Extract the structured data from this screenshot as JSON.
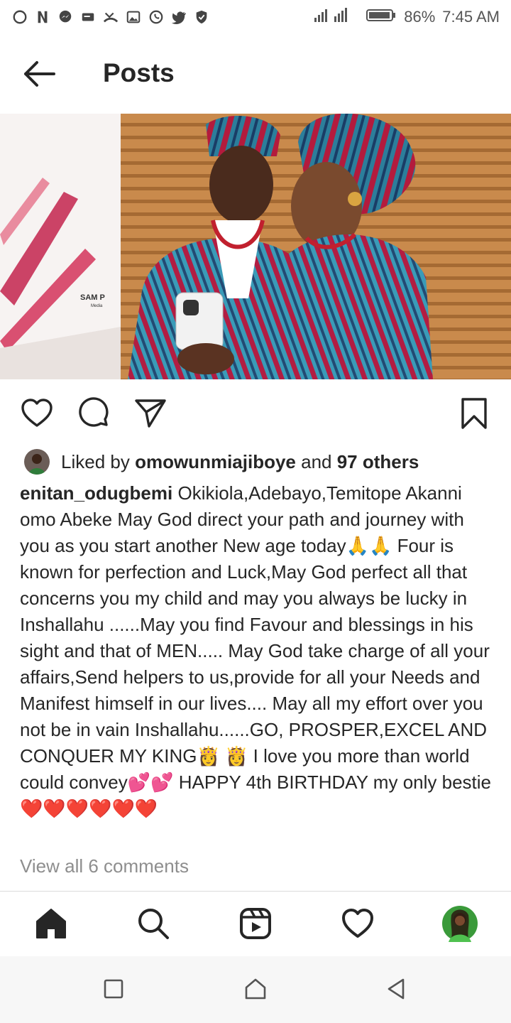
{
  "status_bar": {
    "battery": "86%",
    "time": "7:45 AM",
    "notification_icons": [
      "whatsapp-outline-icon",
      "netflix-icon",
      "messenger-icon",
      "message-icon",
      "missed-call-icon",
      "gallery-icon",
      "whatsapp-icon",
      "twitter-icon",
      "shield-icon"
    ]
  },
  "header": {
    "title": "Posts"
  },
  "post": {
    "image_watermark": "SAM P Media",
    "likes": {
      "prefix": "Liked by ",
      "user": "omowunmiajiboye",
      "middle": " and ",
      "others": "97 others"
    },
    "caption": {
      "username": "enitan_odugbemi",
      "text": " Okikiola,Adebayo,Temitope Akanni omo Abeke May God direct your path and journey with you as you start another New age today🙏🙏 Four  is known for perfection and Luck,May God perfect all that concerns you my child and may you always be lucky in Inshallahu ......May you find Favour and blessings in his sight and that of MEN..... May God take charge of all your affairs,Send helpers to us,provide for all your Needs and Manifest himself in our lives.... May all my effort over you not be in vain Inshallahu......GO, PROSPER,EXCEL AND CONQUER MY KING👸 👸 I love you more than world could convey💕💕 HAPPY 4th BIRTHDAY my only bestie❤️❤️❤️❤️❤️❤️"
    },
    "view_comments": "View all 6 comments"
  },
  "colors": {
    "text": "#262626",
    "muted": "#8e8e8e",
    "heart": "#e0245e"
  }
}
